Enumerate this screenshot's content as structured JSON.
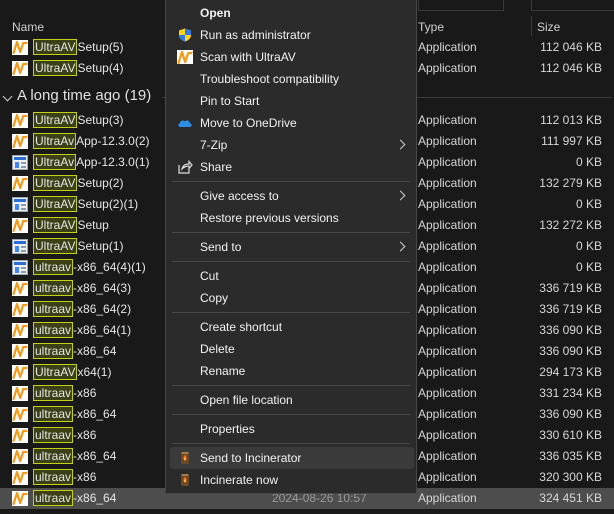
{
  "header": {
    "name_col": "Name",
    "type_col": "Type",
    "size_col": "Size"
  },
  "files_top": [
    {
      "pre": "",
      "hl": "UltraAV",
      "post": "Setup(5)",
      "icon": "av",
      "type": "Application",
      "size": "112 046 KB"
    },
    {
      "pre": "",
      "hl": "UltraAV",
      "post": "Setup(4)",
      "icon": "av",
      "type": "Application",
      "size": "112 046 KB"
    }
  ],
  "group": {
    "title": "A long time ago (19)"
  },
  "files": [
    {
      "hl": "UltraAV",
      "post": "Setup(3)",
      "icon": "av",
      "type": "Application",
      "size": "112 013 KB"
    },
    {
      "hl": "UltraAv",
      "post": "App-12.3.0(2)",
      "icon": "av",
      "type": "Application",
      "size": "111 997 KB"
    },
    {
      "hl": "UltraAv",
      "post": "App-12.3.0(1)",
      "icon": "setup",
      "type": "Application",
      "size": "0 KB"
    },
    {
      "hl": "UltraAV",
      "post": "Setup(2)",
      "icon": "av",
      "type": "Application",
      "size": "132 279 KB"
    },
    {
      "hl": "UltraAV",
      "post": "Setup(2)(1)",
      "icon": "setup",
      "type": "Application",
      "size": "0 KB"
    },
    {
      "hl": "UltraAV",
      "post": "Setup",
      "icon": "av",
      "type": "Application",
      "size": "132 272 KB"
    },
    {
      "hl": "UltraAV",
      "post": "Setup(1)",
      "icon": "setup",
      "type": "Application",
      "size": "0 KB"
    },
    {
      "hl": "ultraav",
      "post": "-x86_64(4)(1)",
      "icon": "setup",
      "type": "Application",
      "size": "0 KB"
    },
    {
      "hl": "ultraav",
      "post": "-x86_64(3)",
      "icon": "av",
      "type": "Application",
      "size": "336 719 KB"
    },
    {
      "hl": "ultraav",
      "post": "-x86_64(2)",
      "icon": "av",
      "type": "Application",
      "size": "336 719 KB"
    },
    {
      "hl": "ultraav",
      "post": "-x86_64(1)",
      "icon": "av",
      "type": "Application",
      "size": "336 090 KB"
    },
    {
      "hl": "ultraav",
      "post": "-x86_64",
      "icon": "av",
      "type": "Application",
      "size": "336 090 KB"
    },
    {
      "hl": "UltraAV",
      "post": "x64(1)",
      "icon": "av",
      "type": "Application",
      "size": "294 173 KB"
    },
    {
      "hl": "ultraav",
      "post": "-x86",
      "icon": "av",
      "type": "Application",
      "size": "331 234 KB"
    },
    {
      "hl": "ultraav",
      "post": "-x86_64",
      "icon": "av",
      "type": "Application",
      "size": "336 090 KB"
    },
    {
      "hl": "ultraav",
      "post": "-x86",
      "icon": "av",
      "type": "Application",
      "size": "330 610 KB"
    },
    {
      "hl": "ultraav",
      "post": "-x86_64",
      "icon": "av",
      "type": "Application",
      "size": "336 035 KB"
    },
    {
      "hl": "ultraav",
      "post": "-x86",
      "icon": "av",
      "type": "Application",
      "size": "320 300 KB"
    },
    {
      "hl": "ultraav",
      "post": "-x86_64",
      "icon": "av",
      "type": "Application",
      "size": "324 451 KB",
      "date": "2024-08-26 10:57",
      "selected": true
    }
  ],
  "menu": [
    {
      "label": "Open",
      "bold": true,
      "icon": ""
    },
    {
      "label": "Run as administrator",
      "icon": "shield"
    },
    {
      "label": "Scan with UltraAV",
      "icon": "av"
    },
    {
      "label": "Troubleshoot compatibility",
      "icon": ""
    },
    {
      "label": "Pin to Start",
      "icon": ""
    },
    {
      "label": "Move to OneDrive",
      "icon": "cloud"
    },
    {
      "label": "7-Zip",
      "icon": "",
      "submenu": true
    },
    {
      "label": "Share",
      "icon": "share"
    },
    {
      "sep": true
    },
    {
      "label": "Give access to",
      "icon": "",
      "submenu": true
    },
    {
      "label": "Restore previous versions",
      "icon": ""
    },
    {
      "sep": true
    },
    {
      "label": "Send to",
      "icon": "",
      "submenu": true
    },
    {
      "sep": true
    },
    {
      "label": "Cut",
      "icon": ""
    },
    {
      "label": "Copy",
      "icon": ""
    },
    {
      "sep": true
    },
    {
      "label": "Create shortcut",
      "icon": ""
    },
    {
      "label": "Delete",
      "icon": ""
    },
    {
      "label": "Rename",
      "icon": ""
    },
    {
      "sep": true
    },
    {
      "label": "Open file location",
      "icon": ""
    },
    {
      "sep": true
    },
    {
      "label": "Properties",
      "icon": ""
    },
    {
      "sep": true
    },
    {
      "label": "Send to Incinerator",
      "icon": "incinerator",
      "hot": true
    },
    {
      "label": "Incinerate now",
      "icon": "incinerator"
    }
  ],
  "colors": {
    "highlight": "#c3d11a",
    "av_orange": "#f39a1a",
    "bg": "#191919",
    "menu_bg": "#2b2b2b"
  }
}
